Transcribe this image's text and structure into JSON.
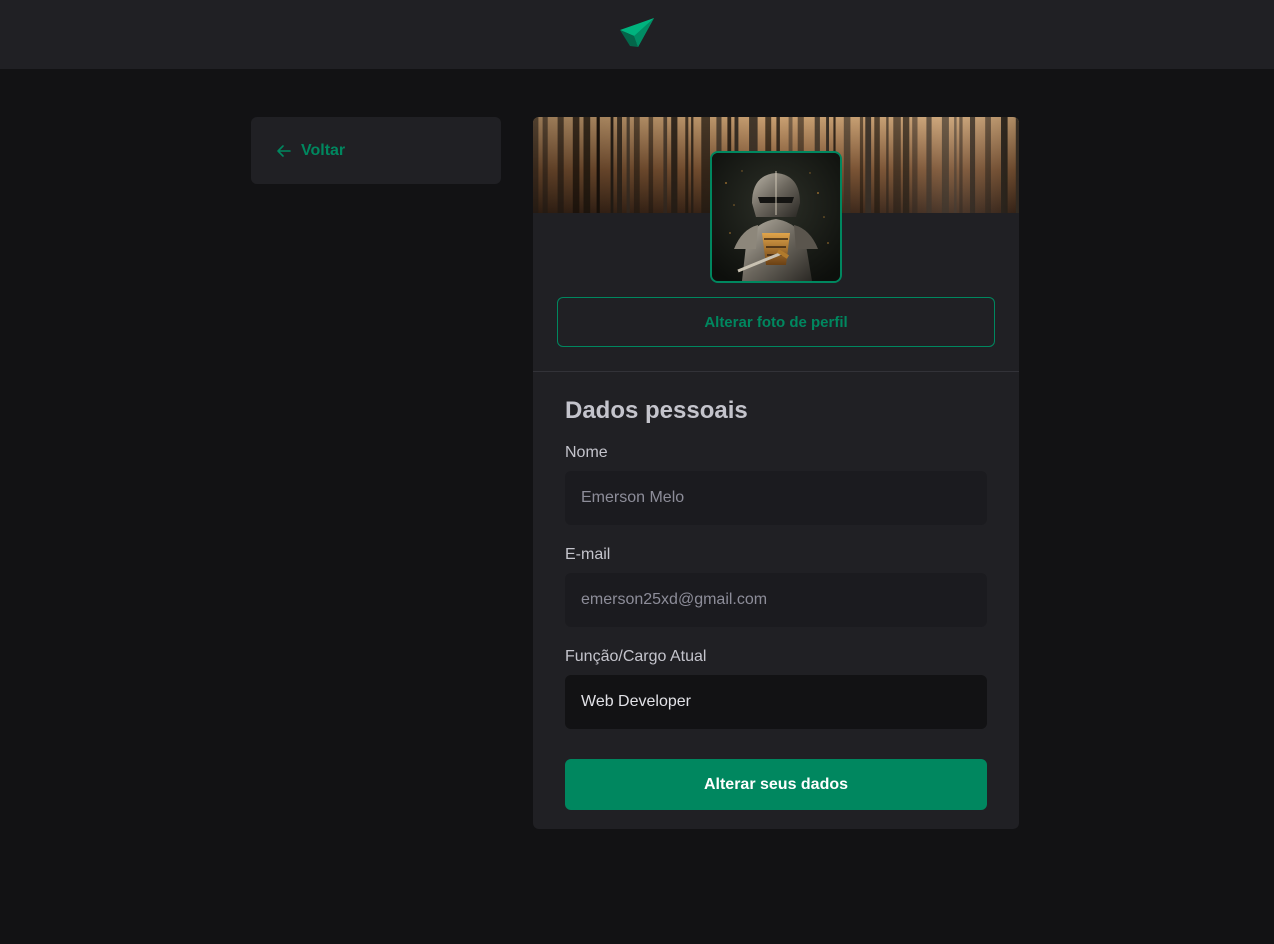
{
  "header": {
    "logo_icon": "paper-plane-logo-icon",
    "accent": "#00875f"
  },
  "back": {
    "icon": "arrow-left-icon",
    "label": "Voltar"
  },
  "profile": {
    "cover_image": "forest-cover-image",
    "avatar_image": "armored-knight-avatar",
    "change_photo_label": "Alterar foto de perfil"
  },
  "form": {
    "title": "Dados pessoais",
    "fields": [
      {
        "label": "Nome",
        "value": "Emerson Melo",
        "editable": false
      },
      {
        "label": "E-mail",
        "value": "emerson25xd@gmail.com",
        "editable": false
      },
      {
        "label": "Função/Cargo Atual",
        "value": "Web Developer",
        "editable": true
      }
    ],
    "submit_label": "Alterar seus dados"
  },
  "colors": {
    "background": "#121214",
    "surface": "#202024",
    "primary": "#00875f",
    "text": "#c4c4cc"
  }
}
